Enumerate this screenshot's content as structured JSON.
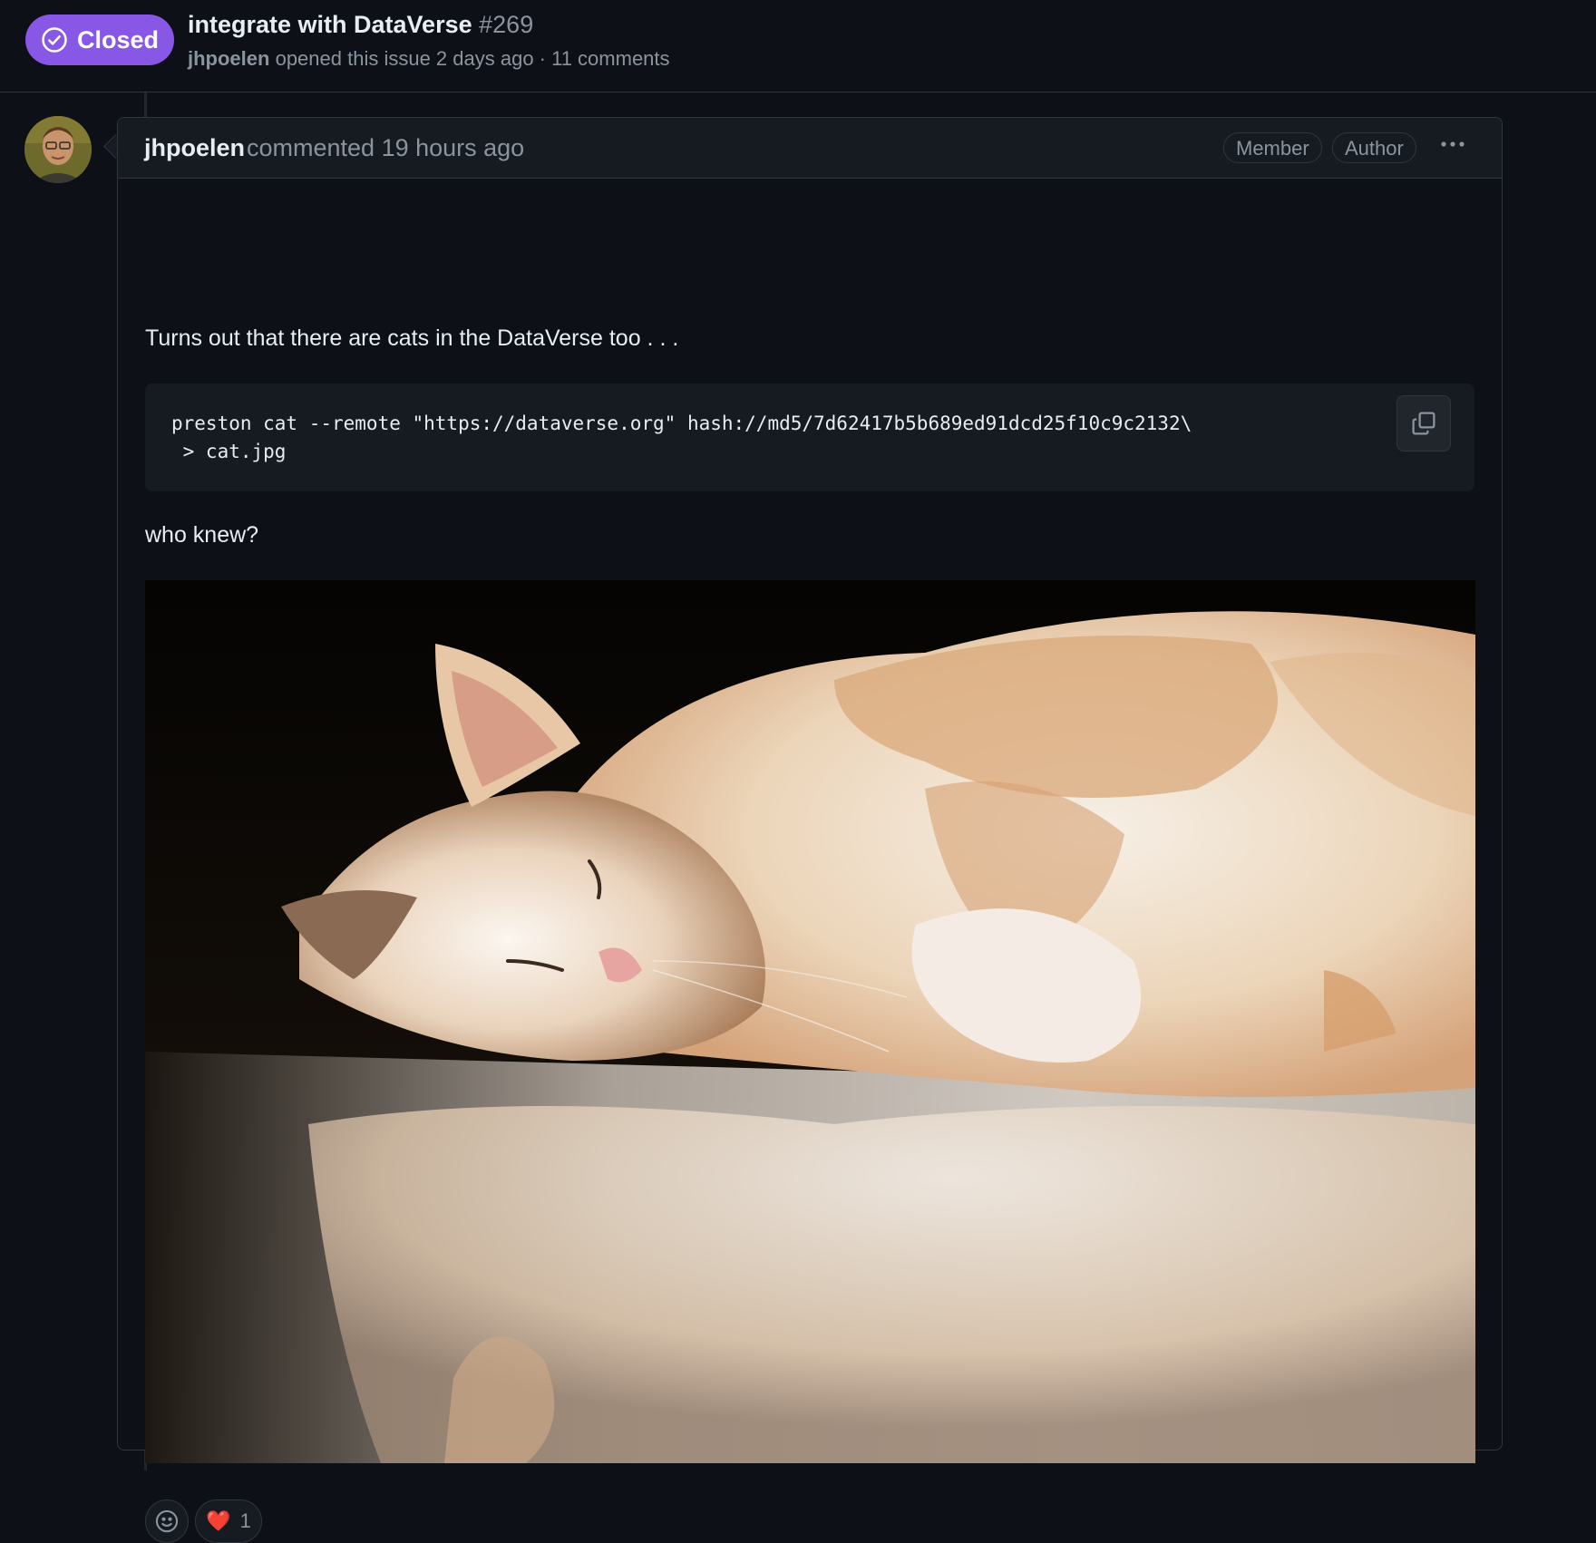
{
  "issue": {
    "state": "Closed",
    "title": "integrate with DataVerse",
    "number": "#269",
    "author": "jhpoelen",
    "meta": "opened this issue 2 days ago · 11 comments"
  },
  "comment": {
    "author": "jhpoelen",
    "time": "commented 19 hours ago",
    "labels": [
      "Member",
      "Author"
    ],
    "menu_icon": "kebab-horizontal-icon",
    "text_1": "Turns out that there are cats in the DataVerse too . . .",
    "code": "preston cat --remote \"https://dataverse.org\" hash://md5/7d62417b5b689ed91dcd25f10c9c2132\\\n > cat.jpg",
    "copy_icon": "copy-icon",
    "text_2": "who knew?",
    "image_subject": "sleeping orange-and-white cat reflected on glossy floor",
    "reactions": {
      "add_icon": "smiley-icon",
      "heart_emoji": "❤️",
      "heart_count": "1"
    }
  },
  "colors": {
    "background": "#0d1117",
    "closed_badge": "#8957e5",
    "border": "#30363d",
    "muted_text": "#8b949e"
  }
}
